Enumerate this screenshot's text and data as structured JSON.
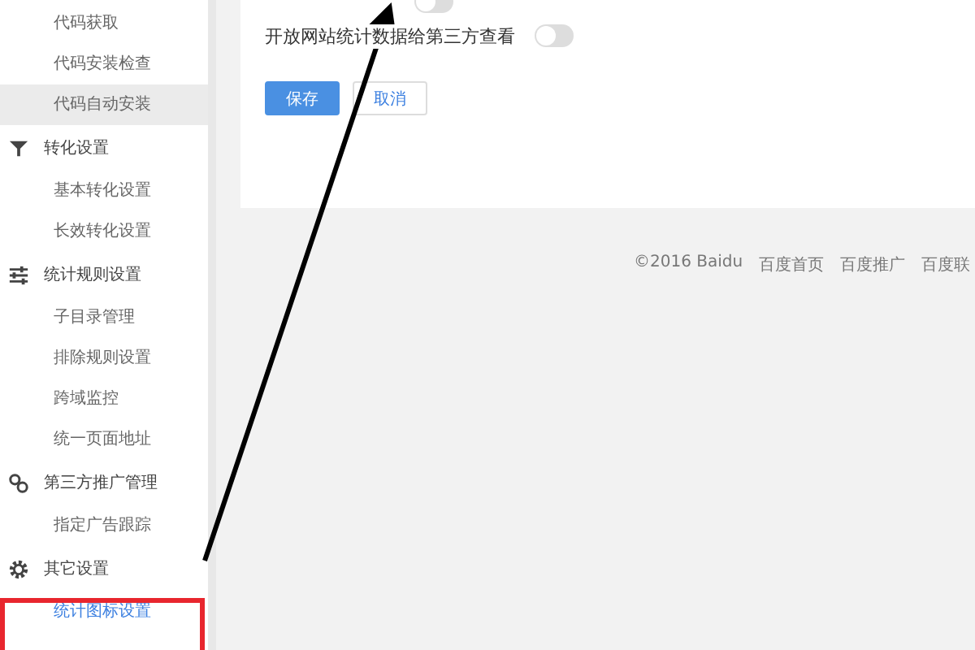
{
  "sidebar": [
    {
      "kind": "item",
      "label": "代码获取",
      "selected": false,
      "hovered": false
    },
    {
      "kind": "item",
      "label": "代码安装检查",
      "selected": false,
      "hovered": false
    },
    {
      "kind": "item",
      "label": "代码自动安装",
      "selected": false,
      "hovered": true
    },
    {
      "kind": "group",
      "label": "转化设置"
    },
    {
      "kind": "item",
      "label": "基本转化设置",
      "selected": false,
      "hovered": false
    },
    {
      "kind": "item",
      "label": "长效转化设置",
      "selected": false,
      "hovered": false
    },
    {
      "kind": "group",
      "label": "统计规则设置"
    },
    {
      "kind": "item",
      "label": "子目录管理",
      "selected": false,
      "hovered": false
    },
    {
      "kind": "item",
      "label": "排除规则设置",
      "selected": false,
      "hovered": false
    },
    {
      "kind": "item",
      "label": "跨域监控",
      "selected": false,
      "hovered": false
    },
    {
      "kind": "item",
      "label": "统一页面地址",
      "selected": false,
      "hovered": false
    },
    {
      "kind": "group",
      "label": "第三方推广管理"
    },
    {
      "kind": "item",
      "label": "指定广告跟踪",
      "selected": false,
      "hovered": false
    },
    {
      "kind": "group",
      "label": "其它设置"
    },
    {
      "kind": "item",
      "label": "统计图标设置",
      "selected": true,
      "hovered": false
    }
  ],
  "settings": [
    {
      "on": false
    },
    {
      "label": "开放网站统计数据给第三方查看",
      "on": false
    }
  ],
  "buttons": [
    {
      "kind": "primary",
      "label": "保存"
    },
    {
      "kind": "secondary",
      "label": "取消"
    }
  ],
  "footer": [
    "©2016 Baidu",
    "百度首页",
    "百度推广",
    "百度联"
  ]
}
